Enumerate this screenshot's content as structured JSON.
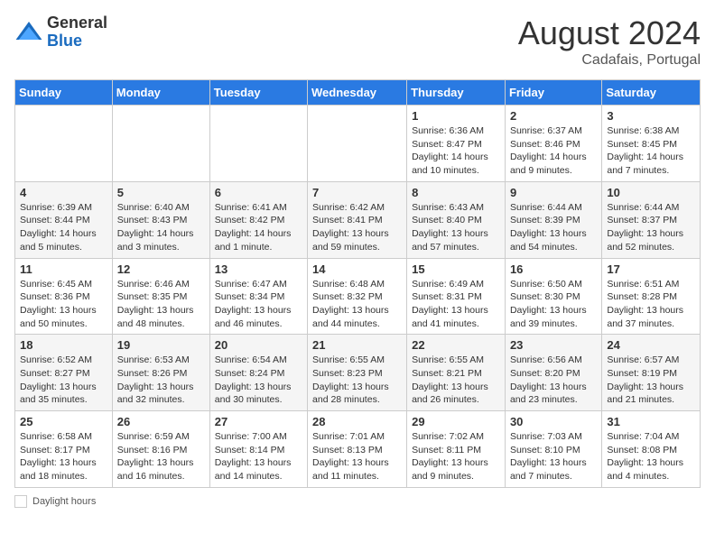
{
  "header": {
    "logo_general": "General",
    "logo_blue": "Blue",
    "month_year": "August 2024",
    "location": "Cadafais, Portugal"
  },
  "days_of_week": [
    "Sunday",
    "Monday",
    "Tuesday",
    "Wednesday",
    "Thursday",
    "Friday",
    "Saturday"
  ],
  "weeks": [
    [
      {
        "day": "",
        "info": ""
      },
      {
        "day": "",
        "info": ""
      },
      {
        "day": "",
        "info": ""
      },
      {
        "day": "",
        "info": ""
      },
      {
        "day": "1",
        "info": "Sunrise: 6:36 AM\nSunset: 8:47 PM\nDaylight: 14 hours and 10 minutes."
      },
      {
        "day": "2",
        "info": "Sunrise: 6:37 AM\nSunset: 8:46 PM\nDaylight: 14 hours and 9 minutes."
      },
      {
        "day": "3",
        "info": "Sunrise: 6:38 AM\nSunset: 8:45 PM\nDaylight: 14 hours and 7 minutes."
      }
    ],
    [
      {
        "day": "4",
        "info": "Sunrise: 6:39 AM\nSunset: 8:44 PM\nDaylight: 14 hours and 5 minutes."
      },
      {
        "day": "5",
        "info": "Sunrise: 6:40 AM\nSunset: 8:43 PM\nDaylight: 14 hours and 3 minutes."
      },
      {
        "day": "6",
        "info": "Sunrise: 6:41 AM\nSunset: 8:42 PM\nDaylight: 14 hours and 1 minute."
      },
      {
        "day": "7",
        "info": "Sunrise: 6:42 AM\nSunset: 8:41 PM\nDaylight: 13 hours and 59 minutes."
      },
      {
        "day": "8",
        "info": "Sunrise: 6:43 AM\nSunset: 8:40 PM\nDaylight: 13 hours and 57 minutes."
      },
      {
        "day": "9",
        "info": "Sunrise: 6:44 AM\nSunset: 8:39 PM\nDaylight: 13 hours and 54 minutes."
      },
      {
        "day": "10",
        "info": "Sunrise: 6:44 AM\nSunset: 8:37 PM\nDaylight: 13 hours and 52 minutes."
      }
    ],
    [
      {
        "day": "11",
        "info": "Sunrise: 6:45 AM\nSunset: 8:36 PM\nDaylight: 13 hours and 50 minutes."
      },
      {
        "day": "12",
        "info": "Sunrise: 6:46 AM\nSunset: 8:35 PM\nDaylight: 13 hours and 48 minutes."
      },
      {
        "day": "13",
        "info": "Sunrise: 6:47 AM\nSunset: 8:34 PM\nDaylight: 13 hours and 46 minutes."
      },
      {
        "day": "14",
        "info": "Sunrise: 6:48 AM\nSunset: 8:32 PM\nDaylight: 13 hours and 44 minutes."
      },
      {
        "day": "15",
        "info": "Sunrise: 6:49 AM\nSunset: 8:31 PM\nDaylight: 13 hours and 41 minutes."
      },
      {
        "day": "16",
        "info": "Sunrise: 6:50 AM\nSunset: 8:30 PM\nDaylight: 13 hours and 39 minutes."
      },
      {
        "day": "17",
        "info": "Sunrise: 6:51 AM\nSunset: 8:28 PM\nDaylight: 13 hours and 37 minutes."
      }
    ],
    [
      {
        "day": "18",
        "info": "Sunrise: 6:52 AM\nSunset: 8:27 PM\nDaylight: 13 hours and 35 minutes."
      },
      {
        "day": "19",
        "info": "Sunrise: 6:53 AM\nSunset: 8:26 PM\nDaylight: 13 hours and 32 minutes."
      },
      {
        "day": "20",
        "info": "Sunrise: 6:54 AM\nSunset: 8:24 PM\nDaylight: 13 hours and 30 minutes."
      },
      {
        "day": "21",
        "info": "Sunrise: 6:55 AM\nSunset: 8:23 PM\nDaylight: 13 hours and 28 minutes."
      },
      {
        "day": "22",
        "info": "Sunrise: 6:55 AM\nSunset: 8:21 PM\nDaylight: 13 hours and 26 minutes."
      },
      {
        "day": "23",
        "info": "Sunrise: 6:56 AM\nSunset: 8:20 PM\nDaylight: 13 hours and 23 minutes."
      },
      {
        "day": "24",
        "info": "Sunrise: 6:57 AM\nSunset: 8:19 PM\nDaylight: 13 hours and 21 minutes."
      }
    ],
    [
      {
        "day": "25",
        "info": "Sunrise: 6:58 AM\nSunset: 8:17 PM\nDaylight: 13 hours and 18 minutes."
      },
      {
        "day": "26",
        "info": "Sunrise: 6:59 AM\nSunset: 8:16 PM\nDaylight: 13 hours and 16 minutes."
      },
      {
        "day": "27",
        "info": "Sunrise: 7:00 AM\nSunset: 8:14 PM\nDaylight: 13 hours and 14 minutes."
      },
      {
        "day": "28",
        "info": "Sunrise: 7:01 AM\nSunset: 8:13 PM\nDaylight: 13 hours and 11 minutes."
      },
      {
        "day": "29",
        "info": "Sunrise: 7:02 AM\nSunset: 8:11 PM\nDaylight: 13 hours and 9 minutes."
      },
      {
        "day": "30",
        "info": "Sunrise: 7:03 AM\nSunset: 8:10 PM\nDaylight: 13 hours and 7 minutes."
      },
      {
        "day": "31",
        "info": "Sunrise: 7:04 AM\nSunset: 8:08 PM\nDaylight: 13 hours and 4 minutes."
      }
    ]
  ],
  "legend": {
    "box_label": "Daylight hours"
  }
}
